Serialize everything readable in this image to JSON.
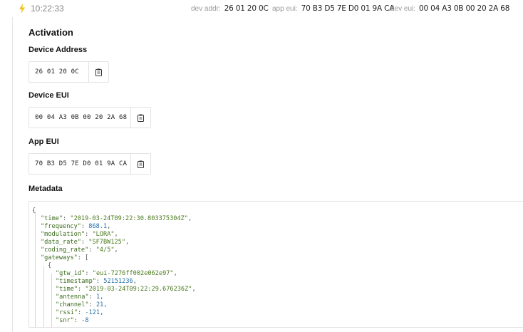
{
  "header": {
    "time": "10:22:33",
    "dev_addr_label": "dev addr:",
    "dev_addr": "26 01 20 0C",
    "app_eui_label": "app eui:",
    "app_eui": "70 B3 D5 7E D0 01 9A CA",
    "dev_eui_label": "dev eui:",
    "dev_eui": "00 04 A3 0B 00 20 2A 68"
  },
  "activation": {
    "title": "Activation",
    "device_address_label": "Device Address",
    "device_address": "26 01 20 0C",
    "device_eui_label": "Device EUI",
    "device_eui": "00 04 A3 0B 00 20 2A 68",
    "app_eui_label": "App EUI",
    "app_eui": "70 B3 D5 7E D0 01 9A CA",
    "metadata_label": "Metadata"
  },
  "icons": {
    "event": "lightning-bolt-icon",
    "copy": "clipboard-icon"
  },
  "colors": {
    "accent_bolt": "#f0c419",
    "json_key": "#3b6b1c",
    "json_string": "#4b7a1e",
    "json_number": "#1f6fa8"
  },
  "metadata": {
    "open_brace": "{",
    "time_key": "\"time\"",
    "time_val": "\"2019-03-24T09:22:30.803375304Z\"",
    "frequency_key": "\"frequency\"",
    "frequency_val": "868.1",
    "modulation_key": "\"modulation\"",
    "modulation_val": "\"LORA\"",
    "data_rate_key": "\"data_rate\"",
    "data_rate_val": "\"SF7BW125\"",
    "coding_rate_key": "\"coding_rate\"",
    "coding_rate_val": "\"4/5\"",
    "gateways_key": "\"gateways\"",
    "gateways_open": "[",
    "gw_open_brace": "{",
    "gtw_id_key": "\"gtw_id\"",
    "gtw_id_val": "\"eui-7276ff002e062e97\"",
    "timestamp_key": "\"timestamp\"",
    "timestamp_val": "52151236",
    "gw_time_key": "\"time\"",
    "gw_time_val": "\"2019-03-24T09:22:29.676236Z\"",
    "antenna_key": "\"antenna\"",
    "antenna_val": "1",
    "channel_key": "\"channel\"",
    "channel_val": "21",
    "rssi_key": "\"rssi\"",
    "rssi_val": "-121",
    "snr_key": "\"snr\"",
    "snr_val": "-8"
  }
}
